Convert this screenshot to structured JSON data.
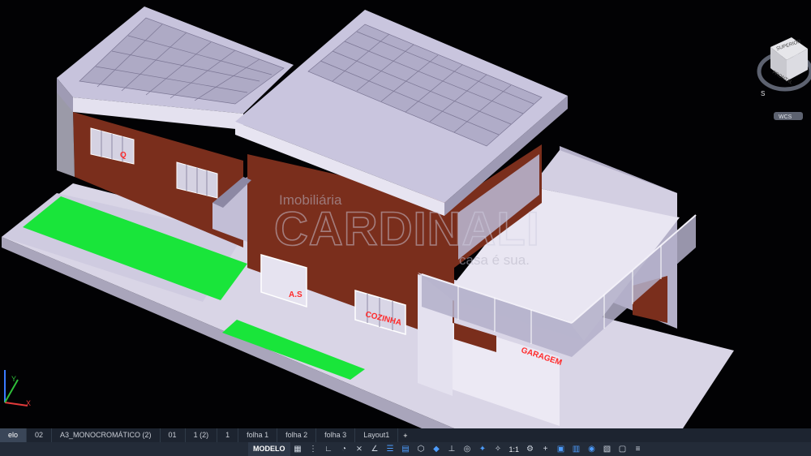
{
  "viewcube": {
    "top_label": "SUPERIOR",
    "front_label": "FRONTAL",
    "compass_south": "S",
    "wcs_label": "WCS"
  },
  "watermark": {
    "line1": "Imobiliária",
    "line2": "CARDINALI",
    "line3": "casa é sua."
  },
  "labels": {
    "room1": "Q",
    "room2": "A.S",
    "room3": "COZINHA",
    "garage": "GARAGEM"
  },
  "ucs": {
    "x_label": "X",
    "y_label": "Y"
  },
  "layout_tabs": [
    {
      "label": "elo",
      "active": true
    },
    {
      "label": "02",
      "active": false
    },
    {
      "label": "A3_MONOCROMÁTICO (2)",
      "active": false
    },
    {
      "label": "01",
      "active": false
    },
    {
      "label": "1 (2)",
      "active": false
    },
    {
      "label": "1",
      "active": false
    },
    {
      "label": "folha 1",
      "active": false
    },
    {
      "label": "folha 2",
      "active": false
    },
    {
      "label": "folha 3",
      "active": false
    },
    {
      "label": "Layout1",
      "active": false
    }
  ],
  "add_tab_label": "+",
  "statusbar": {
    "model_label": "MODELO",
    "scale_label": "1:1",
    "icons": [
      "grid-icon",
      "snap-icon",
      "ortho-icon",
      "polar-icon",
      "osnap-icon",
      "otrack-icon",
      "lineweight-icon",
      "transparency-icon",
      "selection-cycling-icon",
      "3d-osnap-icon",
      "dynamic-ucs-icon",
      "selection-filter-icon",
      "gizmo-icon",
      "annotation-visibility-icon",
      "autoscale-icon",
      "annotation-scale-icon",
      "workspace-icon",
      "annotation-monitor-icon",
      "units-icon",
      "quick-properties-icon",
      "lock-ui-icon",
      "isolate-objects-icon",
      "hardware-acceleration-icon",
      "clean-screen-icon",
      "customize-icon"
    ],
    "accent_color": "#4d9dff"
  },
  "colors": {
    "background": "#020204",
    "wall_brick": "#7a2e1c",
    "roof": "#bdb8d6",
    "lawn": "#19e53a",
    "slab": "#dedaea"
  }
}
